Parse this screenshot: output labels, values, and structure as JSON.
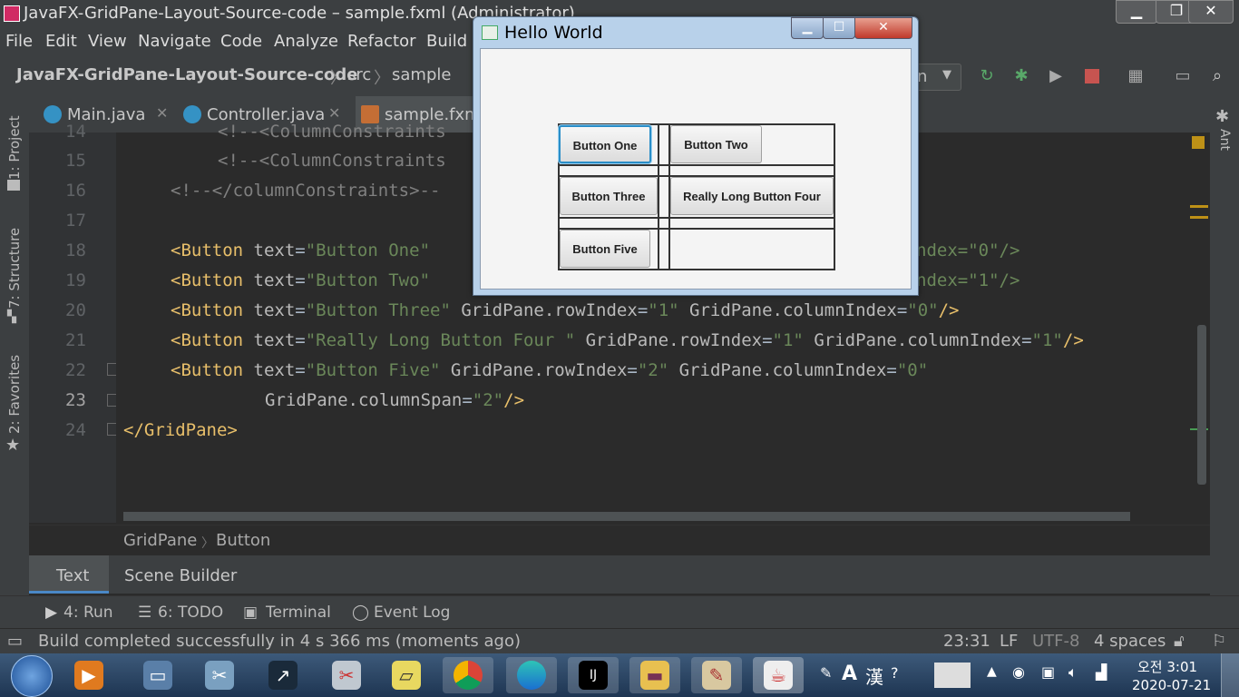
{
  "ide": {
    "title": "JavaFX-GridPane-Layout-Source-code – sample.fxml (Administrator)",
    "menu": [
      "File",
      "Edit",
      "View",
      "Navigate",
      "Code",
      "Analyze",
      "Refactor",
      "Build"
    ],
    "nav": {
      "project": "JavaFX-GridPane-Layout-Source-code",
      "src": "src",
      "pkg": "sample",
      "run_config": "n"
    },
    "tabs": [
      {
        "label": "Main.java"
      },
      {
        "label": "Controller.java"
      },
      {
        "label": "sample.fxml"
      }
    ],
    "left_tools": {
      "project": "1: Project",
      "structure": "7: Structure",
      "favorites": "2: Favorites"
    },
    "right_tools": {
      "ant": "Ant"
    },
    "line_numbers": [
      "14",
      "15",
      "16",
      "17",
      "18",
      "19",
      "20",
      "21",
      "22",
      "23",
      "24"
    ],
    "code": {
      "l14": "<!--<ColumnConstraints",
      "l15": "<!--<ColumnConstraints",
      "l16": "<!--</columnConstraints>--",
      "l18_tail": "ndex=\"0\"/>",
      "l19_tail": "ndex=\"1\"/>",
      "l22_a": "<Button",
      "l22_b": "text",
      "l22_c": "\"Button Five\"",
      "l22_d": "GridPane.rowIndex",
      "l22_e": "\"2\"",
      "l22_f": "GridPane.columnIndex",
      "l22_g": "\"0\"",
      "l23": "GridPane.columnSpan",
      "l23_v": "\"2\"",
      "l24": "</GridPane>"
    },
    "breadcrumbs": [
      "GridPane",
      "Button"
    ],
    "editor_tabs": [
      "Text",
      "Scene Builder"
    ],
    "tool_windows": [
      "4: Run",
      "6: TODO",
      "Terminal",
      "Event Log"
    ],
    "status": {
      "message": "Build completed successfully in 4 s 366 ms (moments ago)",
      "position": "23:31",
      "line_sep": "LF",
      "encoding": "UTF-8",
      "indent": "4 spaces"
    }
  },
  "hello_window": {
    "title": "Hello World",
    "buttons": {
      "one": "Button One",
      "two": "Button Two",
      "three": "Button Three",
      "four": "Really Long Button Four",
      "five": "Button Five"
    }
  },
  "taskbar": {
    "ime_a": "A",
    "ime_han": "漢",
    "time": "오전 3:01",
    "date": "2020-07-21"
  }
}
